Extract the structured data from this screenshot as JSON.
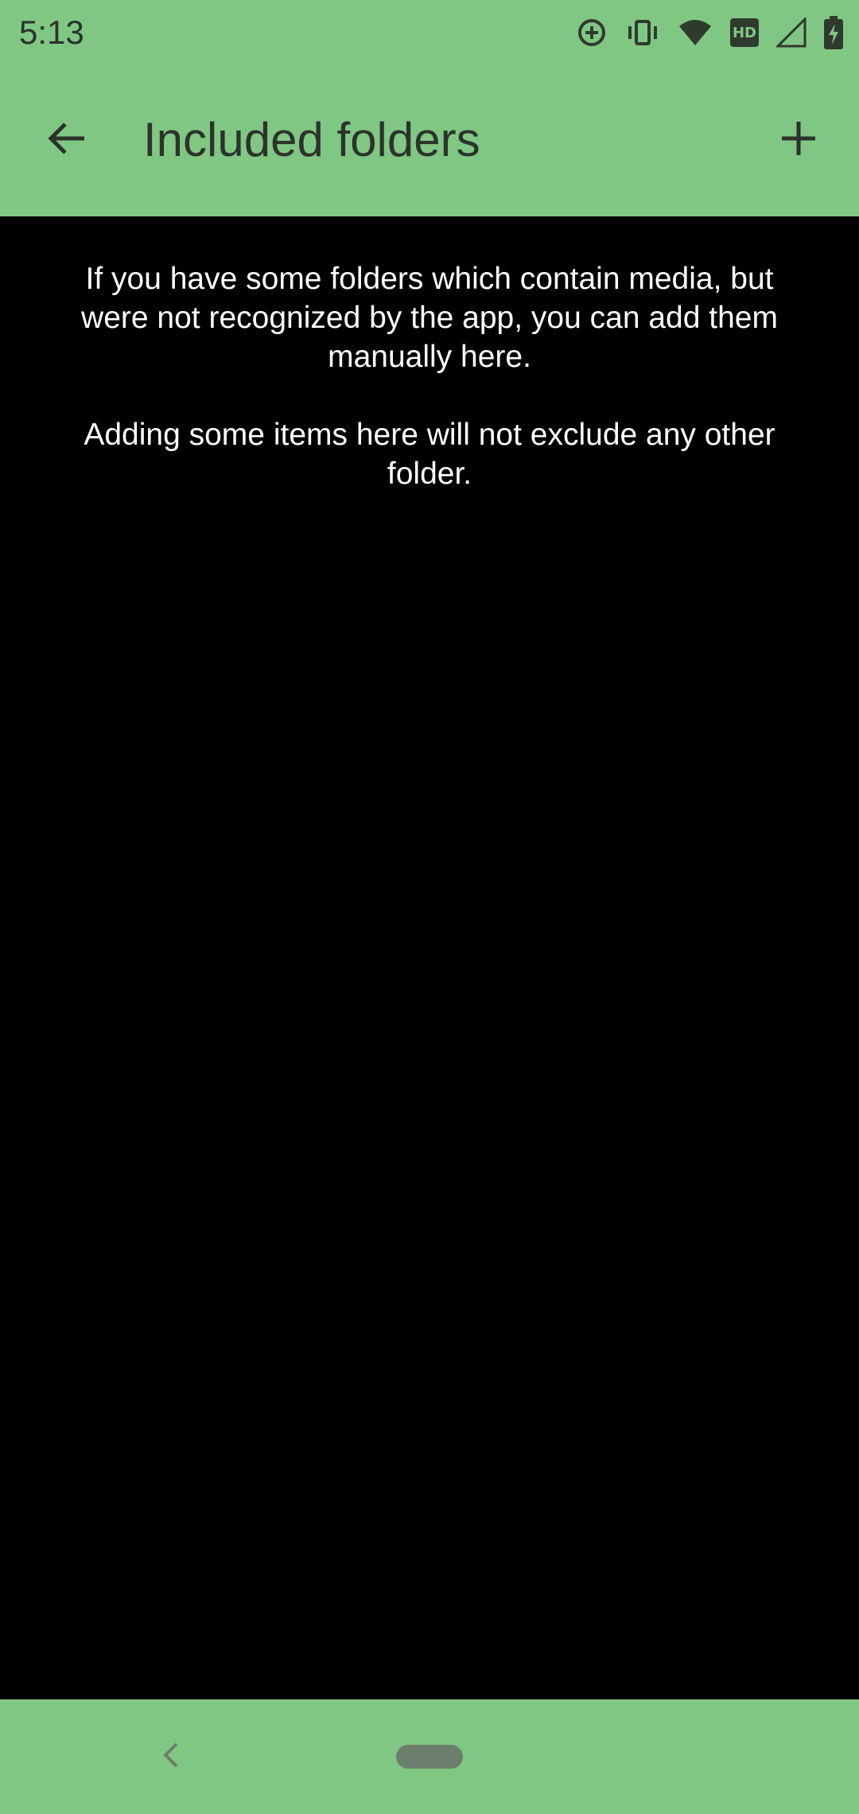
{
  "status_bar": {
    "time": "5:13",
    "icons": [
      "data-saver-icon",
      "vibrate-icon",
      "wifi-icon",
      "hd-icon",
      "cell-signal-icon",
      "battery-charging-icon"
    ],
    "hd_label": "HD"
  },
  "app_bar": {
    "title": "Included folders",
    "back_icon": "arrow-back-icon",
    "add_icon": "plus-icon",
    "background": "#81C784"
  },
  "content": {
    "paragraph_1": "If you have some folders which contain media, but were not recognized by the app, you can add them manually here.",
    "paragraph_2": "Adding some items here will not exclude any other folder.",
    "background": "#000000"
  },
  "nav_bar": {
    "back_icon": "nav-back-chevron-icon",
    "home_icon": "home-pill-icon"
  }
}
